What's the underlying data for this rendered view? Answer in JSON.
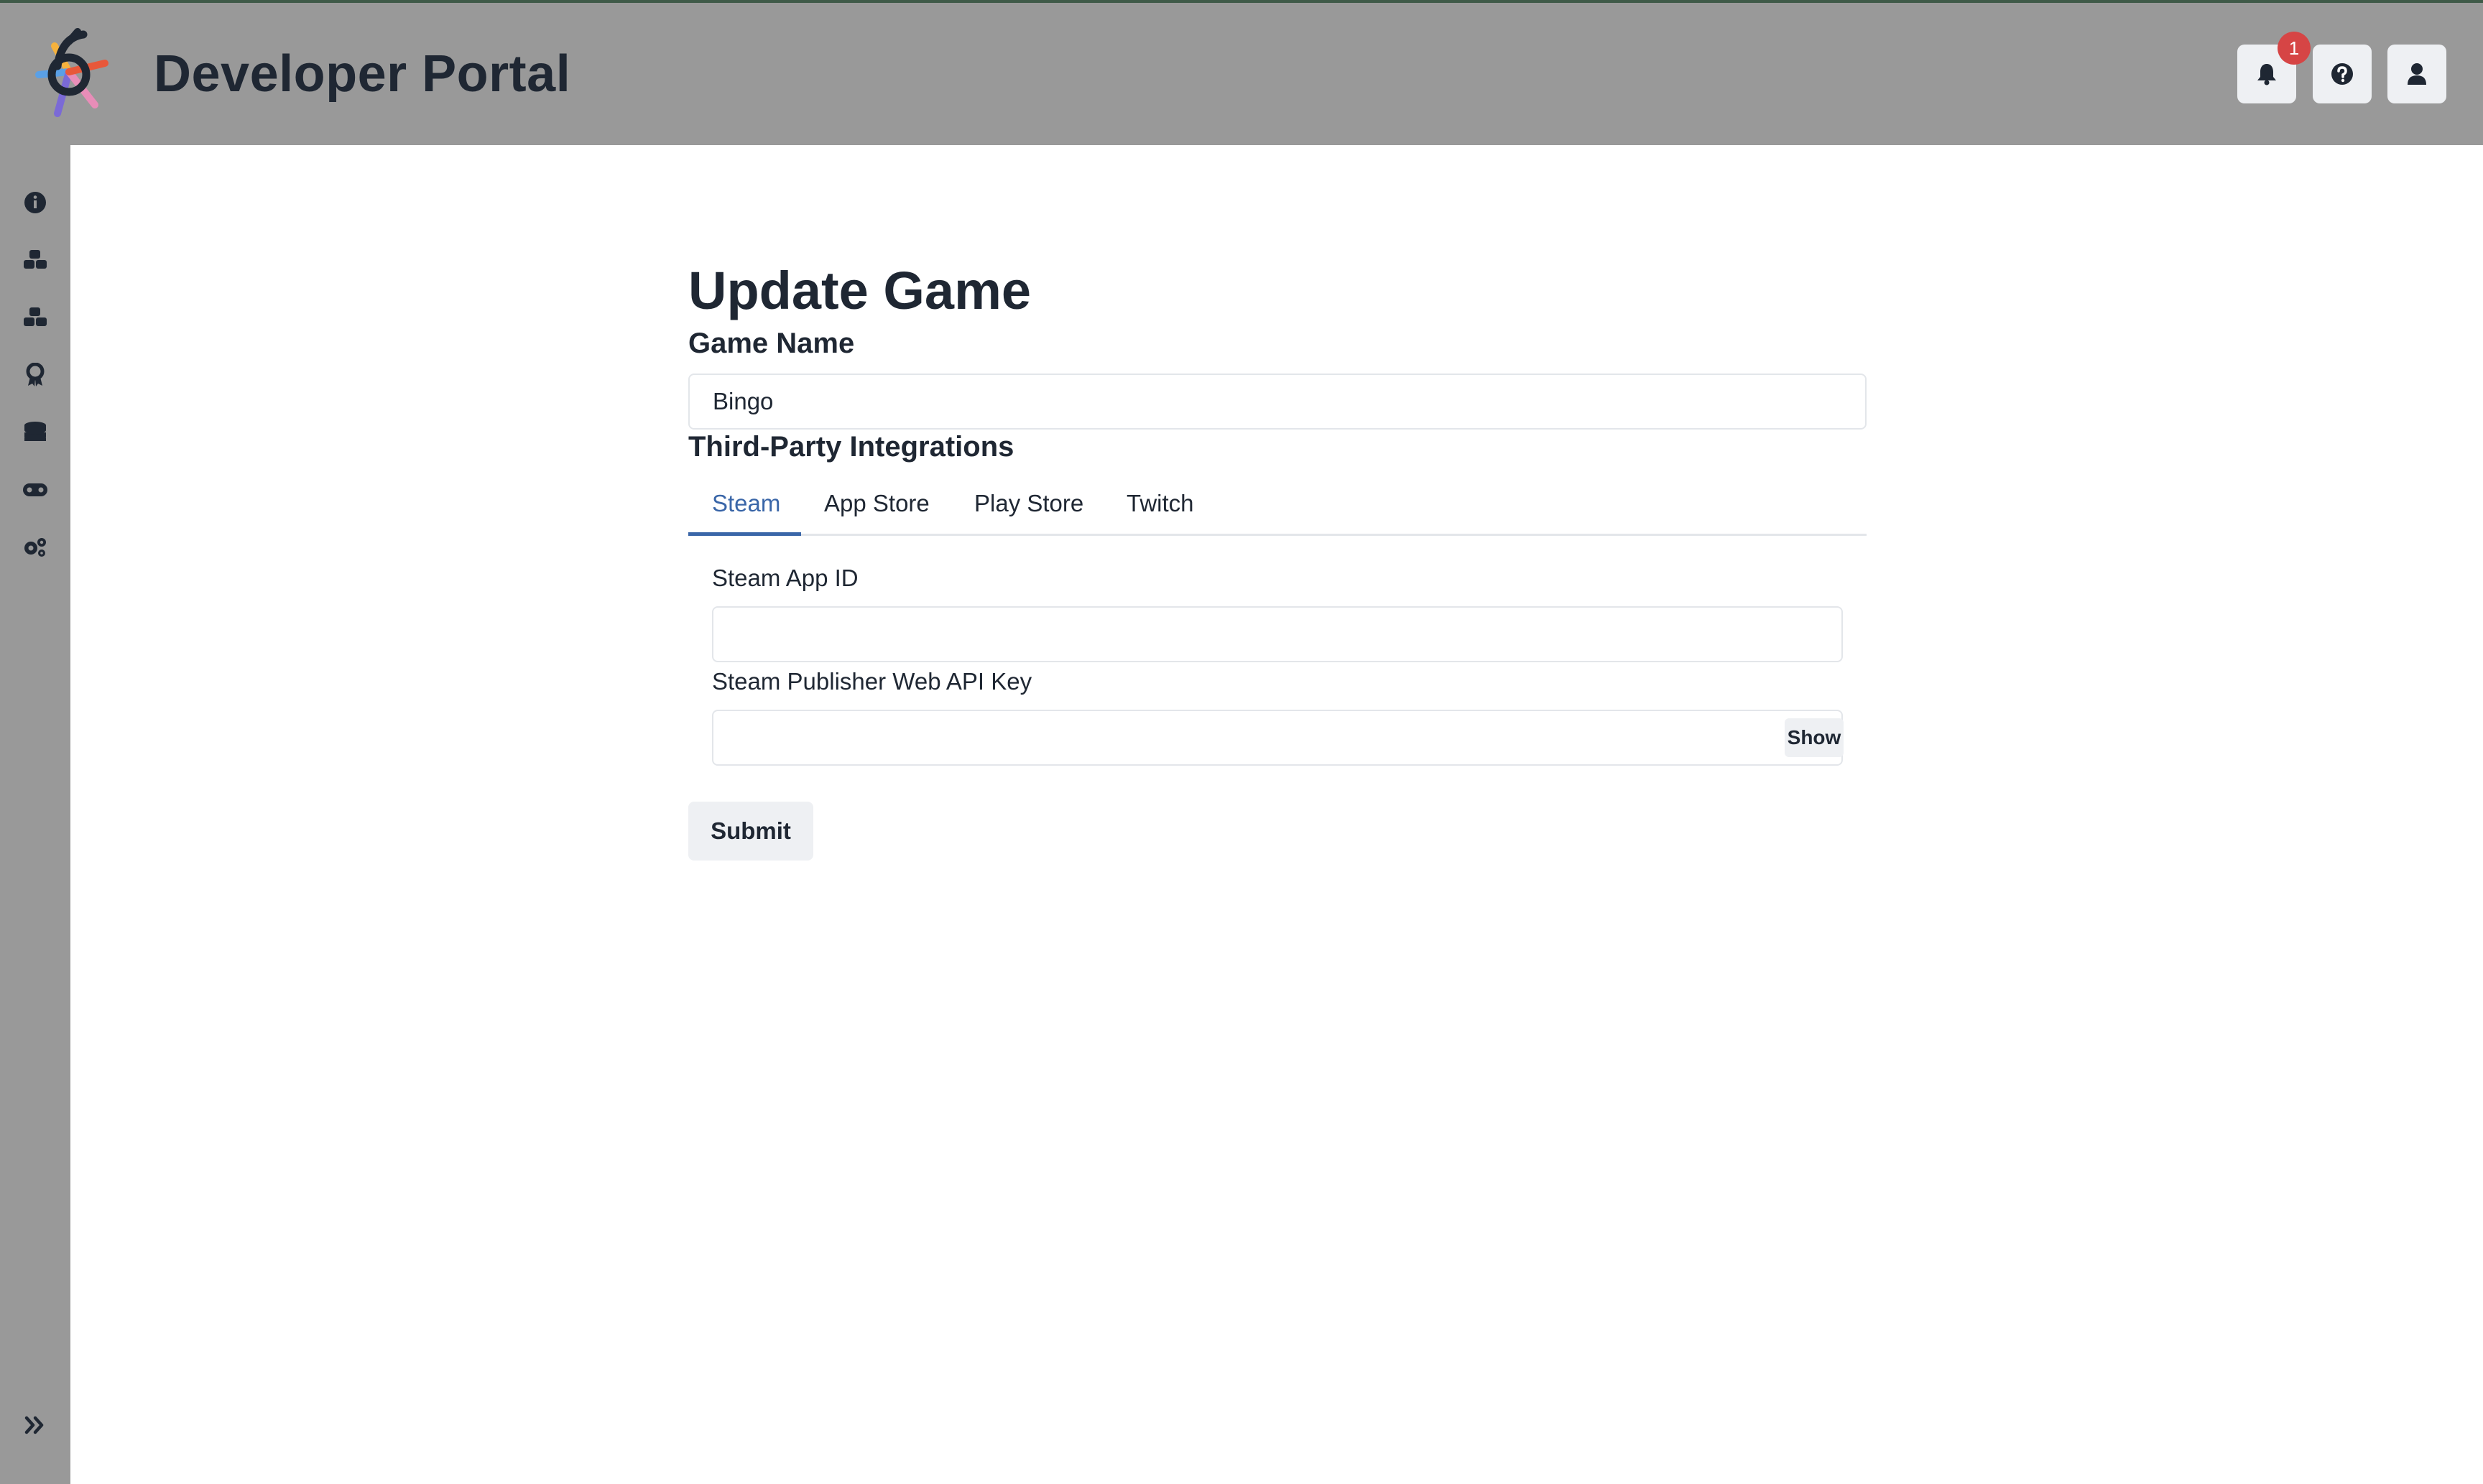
{
  "header": {
    "title": "Developer Portal",
    "notification_count": "1",
    "logo_icon": "six-star-logo",
    "buttons": [
      "bell-icon",
      "question-icon",
      "user-icon"
    ]
  },
  "sidebar": {
    "items": [
      "info-icon",
      "cubes-icon",
      "cubes-alt-icon",
      "award-icon",
      "coins-icon",
      "gamepad-icon",
      "gears-icon"
    ],
    "expand_icon": "double-chevron-right-icon"
  },
  "form": {
    "title": "Update Game",
    "game_name_label": "Game Name",
    "game_name_value": "Bingo",
    "integrations_label": "Third-Party Integrations",
    "tabs": [
      {
        "label": "Steam",
        "active": true
      },
      {
        "label": "App Store",
        "active": false
      },
      {
        "label": "Play Store",
        "active": false
      },
      {
        "label": "Twitch",
        "active": false
      }
    ],
    "steam_app_id_label": "Steam App ID",
    "steam_app_id_value": "",
    "steam_api_key_label": "Steam Publisher Web API Key",
    "steam_api_key_value": "",
    "show_label": "Show",
    "submit_label": "Submit"
  },
  "colors": {
    "header_bg": "#999999",
    "accent": "#3a66a8",
    "badge": "#d64545"
  }
}
